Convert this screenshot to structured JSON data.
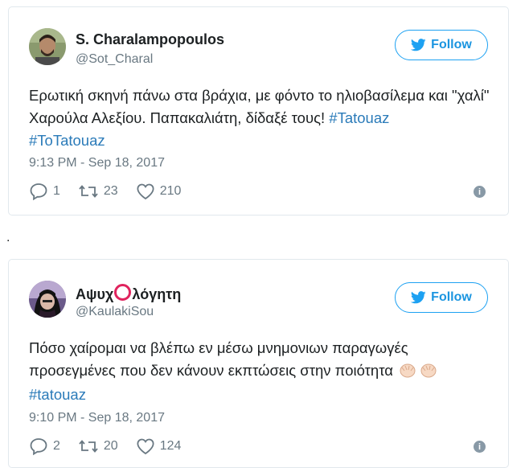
{
  "tweets": [
    {
      "name": "S. Charalampopoulos",
      "handle": "@Sot_Charal",
      "follow_label": "Follow",
      "text_part1": "Ερωτική σκηνή πάνω στα βράχια, με φόντο το ηλιοβασίλεμα και \"χαλί\" Χαρούλα Αλεξίου. Παπακαλιάτη, δίδαξέ τους! ",
      "hashtag1": "#Tatouaz",
      "hashtag2": "#ToTatouaz",
      "time": "9:13 PM - Sep 18, 2017",
      "replies": "1",
      "retweets": "23",
      "likes": "210"
    },
    {
      "name_part1": "Αψυχ",
      "name_part2": "λόγητη",
      "handle": "@KaulakiSou",
      "follow_label": "Follow",
      "text": "Πόσο χαίρομαι να βλέπω εν μέσω μνημονιων παραγωγές προσεγμένες που δεν κάνουν εκπτώσεις στην ποιότητα ",
      "hashtag": "#tatouaz",
      "time": "9:10 PM - Sep 18, 2017",
      "replies": "2",
      "retweets": "20",
      "likes": "124"
    }
  ],
  "separator": ".",
  "colors": {
    "accent": "#1da1f2",
    "hashtag": "#2b7bb9",
    "muted": "#697882"
  }
}
